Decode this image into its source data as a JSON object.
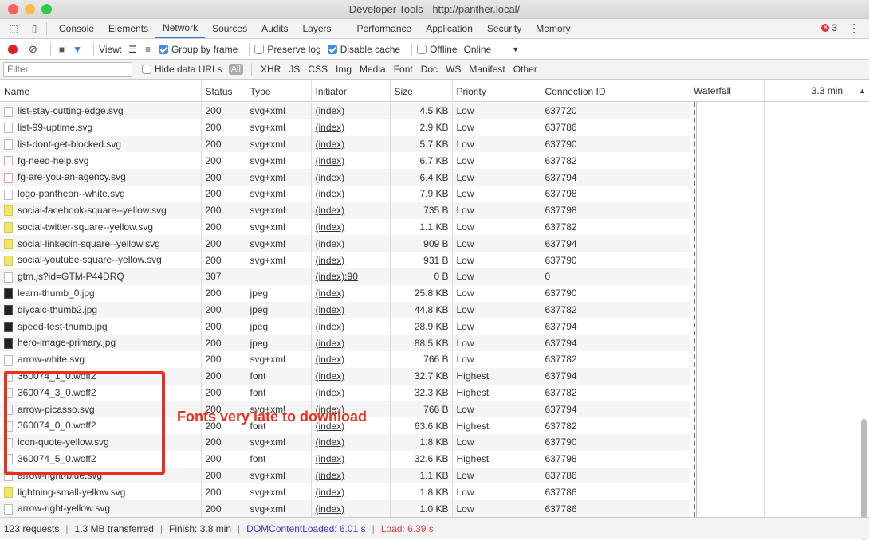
{
  "window": {
    "title": "Developer Tools - http://panther.local/"
  },
  "tabs": [
    "Console",
    "Elements",
    "Network",
    "Sources",
    "Audits",
    "Layers",
    "Performance",
    "Application",
    "Security",
    "Memory"
  ],
  "active_tab": "Network",
  "error_count": "3",
  "toolbar": {
    "view_label": "View:",
    "group_by_frame": "Group by frame",
    "preserve_log": "Preserve log",
    "disable_cache": "Disable cache",
    "offline": "Offline",
    "throttle": "Online"
  },
  "filterbar": {
    "placeholder": "Filter",
    "hide_data_urls": "Hide data URLs",
    "all": "All",
    "types": [
      "XHR",
      "JS",
      "CSS",
      "Img",
      "Media",
      "Font",
      "Doc",
      "WS",
      "Manifest",
      "Other"
    ]
  },
  "columns": {
    "name": "Name",
    "status": "Status",
    "type": "Type",
    "initiator": "Initiator",
    "size": "Size",
    "priority": "Priority",
    "connection": "Connection ID",
    "waterfall": "Waterfall",
    "waterfall_time": "3.3 min"
  },
  "rows": [
    {
      "name": "list-stay-cutting-edge.svg",
      "status": "200",
      "type": "svg+xml",
      "initiator": "(index)",
      "size": "4.5 KB",
      "priority": "Low",
      "conn": "637720",
      "icon": "plain"
    },
    {
      "name": "list-99-uptime.svg",
      "status": "200",
      "type": "svg+xml",
      "initiator": "(index)",
      "size": "2.9 KB",
      "priority": "Low",
      "conn": "637786",
      "icon": "plain"
    },
    {
      "name": "list-dont-get-blocked.svg",
      "status": "200",
      "type": "svg+xml",
      "initiator": "(index)",
      "size": "5.7 KB",
      "priority": "Low",
      "conn": "637790",
      "icon": "plain"
    },
    {
      "name": "fg-need-help.svg",
      "status": "200",
      "type": "svg+xml",
      "initiator": "(index)",
      "size": "6.7 KB",
      "priority": "Low",
      "conn": "637782",
      "icon": "pink"
    },
    {
      "name": "fg-are-you-an-agency.svg",
      "status": "200",
      "type": "svg+xml",
      "initiator": "(index)",
      "size": "6.4 KB",
      "priority": "Low",
      "conn": "637794",
      "icon": "pink"
    },
    {
      "name": "logo-pantheon--white.svg",
      "status": "200",
      "type": "svg+xml",
      "initiator": "(index)",
      "size": "7.9 KB",
      "priority": "Low",
      "conn": "637798",
      "icon": "plain"
    },
    {
      "name": "social-facebook-square--yellow.svg",
      "status": "200",
      "type": "svg+xml",
      "initiator": "(index)",
      "size": "735 B",
      "priority": "Low",
      "conn": "637798",
      "icon": "yellow"
    },
    {
      "name": "social-twitter-square--yellow.svg",
      "status": "200",
      "type": "svg+xml",
      "initiator": "(index)",
      "size": "1.1 KB",
      "priority": "Low",
      "conn": "637782",
      "icon": "yellow"
    },
    {
      "name": "social-linkedin-square--yellow.svg",
      "status": "200",
      "type": "svg+xml",
      "initiator": "(index)",
      "size": "909 B",
      "priority": "Low",
      "conn": "637794",
      "icon": "yellow"
    },
    {
      "name": "social-youtube-square--yellow.svg",
      "status": "200",
      "type": "svg+xml",
      "initiator": "(index)",
      "size": "931 B",
      "priority": "Low",
      "conn": "637790",
      "icon": "yellow"
    },
    {
      "name": "gtm.js?id=GTM-P44DRQ",
      "status": "307",
      "type": "",
      "initiator": "(index):90",
      "size": "0 B",
      "priority": "Low",
      "conn": "0",
      "icon": "plain"
    },
    {
      "name": "learn-thumb_0.jpg",
      "status": "200",
      "type": "jpeg",
      "initiator": "(index)",
      "size": "25.8 KB",
      "priority": "Low",
      "conn": "637790",
      "icon": "dark"
    },
    {
      "name": "diycalc-thumb2.jpg",
      "status": "200",
      "type": "jpeg",
      "initiator": "(index)",
      "size": "44.8 KB",
      "priority": "Low",
      "conn": "637782",
      "icon": "dark"
    },
    {
      "name": "speed-test-thumb.jpg",
      "status": "200",
      "type": "jpeg",
      "initiator": "(index)",
      "size": "28.9 KB",
      "priority": "Low",
      "conn": "637794",
      "icon": "dark"
    },
    {
      "name": "hero-image-primary.jpg",
      "status": "200",
      "type": "jpeg",
      "initiator": "(index)",
      "size": "88.5 KB",
      "priority": "Low",
      "conn": "637794",
      "icon": "dark"
    },
    {
      "name": "arrow-white.svg",
      "status": "200",
      "type": "svg+xml",
      "initiator": "(index)",
      "size": "766 B",
      "priority": "Low",
      "conn": "637782",
      "icon": "plain"
    },
    {
      "name": "360074_1_0.woff2",
      "status": "200",
      "type": "font",
      "initiator": "(index)",
      "size": "32.7 KB",
      "priority": "Highest",
      "conn": "637794",
      "icon": "plain"
    },
    {
      "name": "360074_3_0.woff2",
      "status": "200",
      "type": "font",
      "initiator": "(index)",
      "size": "32.3 KB",
      "priority": "Highest",
      "conn": "637782",
      "icon": "plain"
    },
    {
      "name": "arrow-picasso.svg",
      "status": "200",
      "type": "svg+xml",
      "initiator": "(index)",
      "size": "766 B",
      "priority": "Low",
      "conn": "637794",
      "icon": "plain"
    },
    {
      "name": "360074_0_0.woff2",
      "status": "200",
      "type": "font",
      "initiator": "(index)",
      "size": "63.6 KB",
      "priority": "Highest",
      "conn": "637782",
      "icon": "plain"
    },
    {
      "name": "icon-quote-yellow.svg",
      "status": "200",
      "type": "svg+xml",
      "initiator": "(index)",
      "size": "1.8 KB",
      "priority": "Low",
      "conn": "637790",
      "icon": "plain"
    },
    {
      "name": "360074_5_0.woff2",
      "status": "200",
      "type": "font",
      "initiator": "(index)",
      "size": "32.6 KB",
      "priority": "Highest",
      "conn": "637798",
      "icon": "plain"
    },
    {
      "name": "arrow-right-blue.svg",
      "status": "200",
      "type": "svg+xml",
      "initiator": "(index)",
      "size": "1.1 KB",
      "priority": "Low",
      "conn": "637786",
      "icon": "plain"
    },
    {
      "name": "lightning-small-yellow.svg",
      "status": "200",
      "type": "svg+xml",
      "initiator": "(index)",
      "size": "1.8 KB",
      "priority": "Low",
      "conn": "637786",
      "icon": "yellow"
    },
    {
      "name": "arrow-right-yellow.svg",
      "status": "200",
      "type": "svg+xml",
      "initiator": "(index)",
      "size": "1.0 KB",
      "priority": "Low",
      "conn": "637786",
      "icon": "plain"
    }
  ],
  "annotation": "Fonts very late to download",
  "statusbar": {
    "requests": "123 requests",
    "transferred": "1.3 MB transferred",
    "finish": "Finish: 3.8 min",
    "dcl": "DOMContentLoaded: 6.01 s",
    "load": "Load: 6.39 s"
  },
  "colors": {
    "accent": "#3879d9",
    "error": "#e0303a",
    "annotation": "#e8301c",
    "dcl": "#3a3ad0",
    "load": "#e0404a"
  }
}
